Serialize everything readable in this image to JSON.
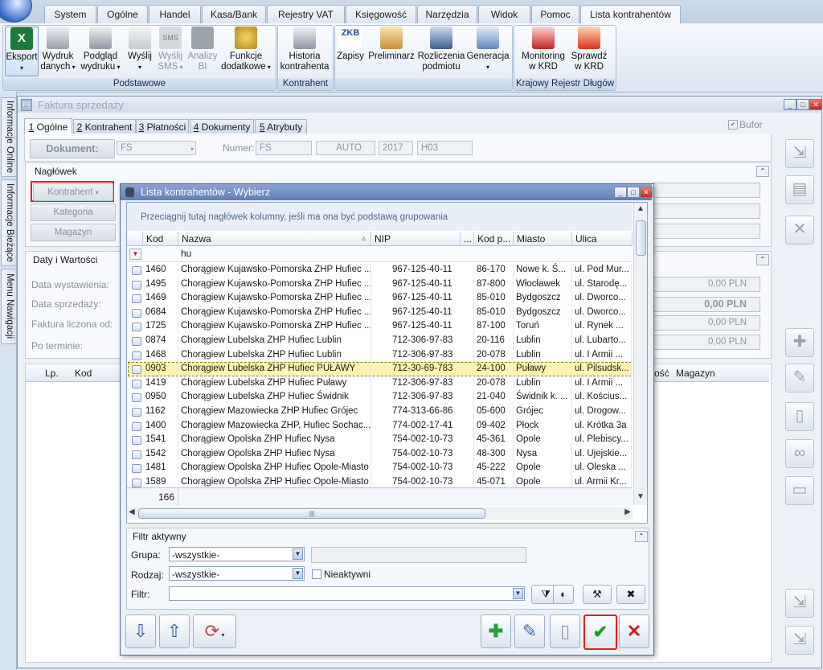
{
  "ribbon": {
    "tabs": [
      "System",
      "Ogólne",
      "Handel",
      "Kasa/Bank",
      "Rejestry VAT",
      "Księgowość",
      "Narzędzia",
      "Widok",
      "Pomoc",
      "Lista kontrahentów"
    ],
    "groups": {
      "podstawowe": {
        "label": "Podstawowe",
        "buttons": {
          "eksport": "Eksport",
          "wydruk_1": "Wydruk",
          "wydruk_2": "danych",
          "podglad_1": "Podgląd",
          "podglad_2": "wydruku",
          "wyslij": "Wyślij",
          "wyslij_sms_1": "Wyślij",
          "wyslij_sms_2": "SMS",
          "analizy_1": "Analizy",
          "analizy_2": "BI",
          "funkcje_1": "Funkcje",
          "funkcje_2": "dodatkowe"
        }
      },
      "kontrahent": {
        "label": "Kontrahent",
        "historia_1": "Historia",
        "historia_2": "kontrahenta"
      },
      "misc": {
        "zapisy": "Zapisy",
        "preliminarz": "Preliminarz",
        "rozliczenia_1": "Rozliczenia",
        "rozliczenia_2": "podmiotu",
        "generacja": "Generacja"
      },
      "krd": {
        "label": "Krajowy Rejestr Długów",
        "monitoring_1": "Monitoring",
        "monitoring_2": "w KRD",
        "sprawdz_1": "Sprawdź",
        "sprawdz_2": "w KRD"
      },
      "icons": {
        "zkb": "ZKB",
        "sms": "SMS"
      }
    }
  },
  "sidebar": {
    "tabs": [
      "Informacje Online",
      "Informacje Bieżące",
      "Menu Nawigacji"
    ]
  },
  "doc": {
    "title": "Faktura sprzedaży",
    "tabs": [
      {
        "num": "1",
        "label": "Ogólne"
      },
      {
        "num": "2",
        "label": "Kontrahent"
      },
      {
        "num": "3",
        "label": "Płatności"
      },
      {
        "num": "4",
        "label": "Dokumenty"
      },
      {
        "num": "5",
        "label": "Atrybuty"
      }
    ],
    "bufor": "Bufor",
    "dokument_label": "Dokument:",
    "dokument_value": "FS",
    "numer_label": "Numer:",
    "numer_parts": [
      "FS",
      "AUTO",
      "2017",
      "H03"
    ],
    "naglowek": "Nagłówek",
    "kontrahent_btn": "Kontrahent",
    "kategoria_btn": "Kategoria",
    "magazyn_btn": "Magazyn",
    "daty": {
      "title": "Daty i Wartości",
      "data_wystawienia": "Data wystawienia:",
      "data_sprzedazy": "Data sprzedaży:",
      "faktura_liczona": "Faktura liczona od:",
      "po_terminie": "Po terminie:",
      "values": [
        "0,00 PLN",
        "0,00 PLN",
        "0,00 PLN",
        "0,00 PLN"
      ]
    },
    "items_header": {
      "lp": "Lp.",
      "kod": "Kod",
      "osc": "ość",
      "magazyn": "Magazyn"
    }
  },
  "dialog": {
    "title": "Lista kontrahentów - Wybierz",
    "group_hint": "Przeciągnij tutaj nagłówek kolumny, jeśli ma ona być podstawą grupowania",
    "columns": {
      "kod": "Kod",
      "nazwa": "Nazwa",
      "sort_icon": "▵",
      "nip": "NIP",
      "dots": "...",
      "kod_p": "Kod p...",
      "miasto": "Miasto",
      "ulica": "Ulica"
    },
    "filter_value": "hu",
    "rows": [
      {
        "kod": "1460",
        "nazwa": "Chorągiew Kujawsko-Pomorska ZHP Hufiec ...",
        "nip": "967-125-40-11",
        "kodp": "86-170",
        "miasto": "Nowe k. Ś...",
        "ulica": "ul. Pod Mur..."
      },
      {
        "kod": "1495",
        "nazwa": "Chorągiew Kujawsko-Pomorska ZHP Hufiec ...",
        "nip": "967-125-40-11",
        "kodp": "87-800",
        "miasto": "Włocławek",
        "ulica": "ul. Starodę..."
      },
      {
        "kod": "1469",
        "nazwa": "Chorągiew Kujawsko-Pomorska ZHP Hufiec ...",
        "nip": "967-125-40-11",
        "kodp": "85-010",
        "miasto": "Bydgoszcz",
        "ulica": "ul. Dworco..."
      },
      {
        "kod": "0684",
        "nazwa": "Chorągiew Kujawsko-Pomorska ZHP Hufiec ...",
        "nip": "967-125-40-11",
        "kodp": "85-010",
        "miasto": "Bydgoszcz",
        "ulica": "ul. Dworco..."
      },
      {
        "kod": "1725",
        "nazwa": "Chorągiew Kujawsko-Pomorska ZHP Hufiec ...",
        "nip": "967-125-40-11",
        "kodp": "87-100",
        "miasto": "Toruń",
        "ulica": "ul. Rynek ..."
      },
      {
        "kod": "0874",
        "nazwa": "Chorągiew Lubelska ZHP Hufiec Lublin",
        "nip": "712-306-97-83",
        "kodp": "20-116",
        "miasto": "Lublin",
        "ulica": "ul. Lubarto..."
      },
      {
        "kod": "1468",
        "nazwa": "Chorągiew Lubelska ZHP Hufiec Lublin",
        "nip": "712-306-97-83",
        "kodp": "20-078",
        "miasto": "Lublin",
        "ulica": "ul. I Armii ..."
      },
      {
        "kod": "0903",
        "nazwa": "Chorągiew Lubelska ZHP Hufiec PUŁAWY",
        "nip": "712-30-69-783",
        "kodp": "24-100",
        "miasto": "Puławy",
        "ulica": "ul. Pilsudsk...",
        "selected": true
      },
      {
        "kod": "1419",
        "nazwa": "Chorągiew Lubelska ZHP Hufiec Puławy",
        "nip": "712-306-97-83",
        "kodp": "20-078",
        "miasto": "Lublin",
        "ulica": "ul. I Armii ..."
      },
      {
        "kod": "0950",
        "nazwa": "Chorągiew Lubelska ZHP Hufiec Świdnik",
        "nip": "712-306-97-83",
        "kodp": "21-040",
        "miasto": "Świdnik k. ...",
        "ulica": "ul. Kościus..."
      },
      {
        "kod": "1162",
        "nazwa": "Chorągiew Mazowiecka ZHP Hufiec Grójec",
        "nip": "774-313-66-86",
        "kodp": "05-600",
        "miasto": "Grójec",
        "ulica": "ul. Drogow..."
      },
      {
        "kod": "1400",
        "nazwa": "Chorągiew Mazowiecka ZHP, Hufiec Sochac...",
        "nip": "774-002-17-41",
        "kodp": "09-402",
        "miasto": "Płock",
        "ulica": "ul. Krótka 3a"
      },
      {
        "kod": "1541",
        "nazwa": "Chorągiew Opolska ZHP Hufiec Nysa",
        "nip": "754-002-10-73",
        "kodp": "45-361",
        "miasto": "Opole",
        "ulica": "ul. Plebiscy..."
      },
      {
        "kod": "1542",
        "nazwa": "Chorągiew Opolska ZHP Hufiec Nysa",
        "nip": "754-002-10-73",
        "kodp": "48-300",
        "miasto": "Nysa",
        "ulica": "ul. Ujejskie..."
      },
      {
        "kod": "1481",
        "nazwa": "Chorągiew Opolska ZHP Hufiec Opole-Miasto",
        "nip": "754-002-10-73",
        "kodp": "45-222",
        "miasto": "Opole",
        "ulica": "ul. Oleska ..."
      },
      {
        "kod": "1589",
        "nazwa": "Chorągiew Opolska ZHP Hufiec Opole-Miasto",
        "nip": "754-002-10-73",
        "kodp": "45-071",
        "miasto": "Opole",
        "ulica": "ul. Armii Kr..."
      }
    ],
    "count": "166",
    "scroll_grip": "|||",
    "filter_panel": {
      "title": "Filtr aktywny",
      "grupa_label": "Grupa:",
      "grupa_value": "-wszystkie-",
      "rodzaj_label": "Rodzaj:",
      "rodzaj_value": "-wszystkie-",
      "nieaktywni": "Nieaktywni",
      "filtr_label": "Filtr:"
    }
  },
  "colors": {
    "selected_row": "#fff2b3",
    "highlight_red": "#e0201c",
    "dialog_title": "#5e7fb8"
  }
}
